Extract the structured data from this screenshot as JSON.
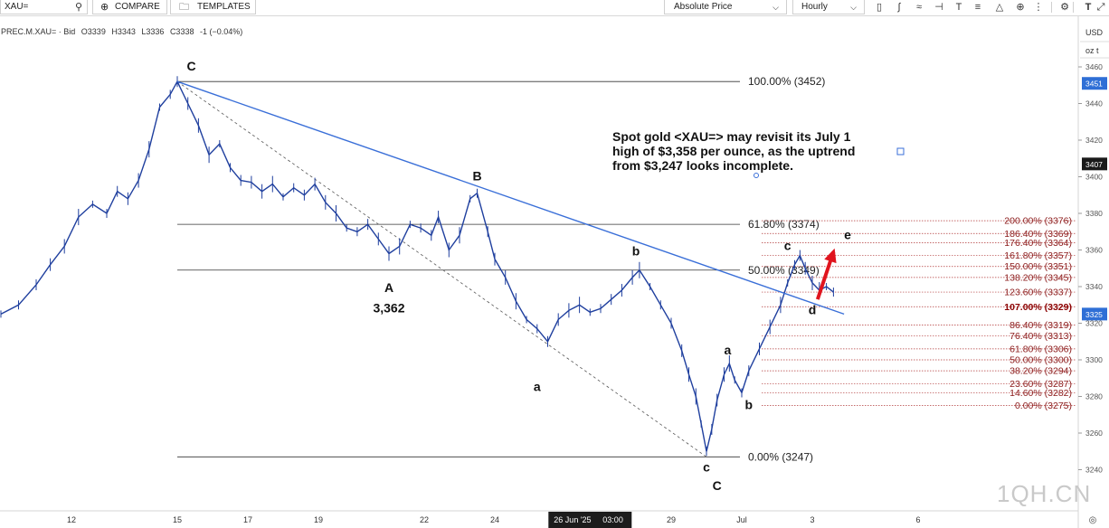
{
  "toolbar": {
    "symbol_value": "XAU=",
    "compare_label": "COMPARE",
    "templates_label": "TEMPLATES",
    "price_type": "Absolute Price",
    "interval": "Hourly",
    "tools": [
      "candles-icon",
      "indicators-icon",
      "wave-icon",
      "crosshair-icon",
      "text-tool-icon",
      "fib-tool-icon",
      "pattern-tool-icon",
      "zoom-icon",
      "more-icon",
      "settings-icon",
      "logo-icon"
    ]
  },
  "legend": {
    "instrument": "PREC.M.XAU= · Bid",
    "open": "O3339",
    "high": "H3343",
    "low": "L3336",
    "close": "C3338",
    "change": "-1 (−0.04%)"
  },
  "price_axis": {
    "currency": "USD",
    "unit": "oz t",
    "ticks": [
      3460,
      3440,
      3420,
      3400,
      3380,
      3360,
      3340,
      3320,
      3300,
      3280,
      3260,
      3240
    ],
    "badges": [
      {
        "label": "3451",
        "value": 3451,
        "color": "#2f6fd6"
      },
      {
        "label": "3407",
        "value": 3407,
        "color": "#1a1a1a"
      },
      {
        "label": "3325",
        "value": 3325,
        "color": "#2f6fd6"
      }
    ]
  },
  "time_axis": {
    "ticks": [
      {
        "label": "12",
        "day": 12
      },
      {
        "label": "15",
        "day": 15
      },
      {
        "label": "17",
        "day": 17
      },
      {
        "label": "19",
        "day": 19
      },
      {
        "label": "22",
        "day": 22
      },
      {
        "label": "24",
        "day": 24
      },
      {
        "label": "29",
        "day": 29
      },
      {
        "label": "Jul",
        "day": 31
      },
      {
        "label": "3",
        "day": 33
      },
      {
        "label": "6",
        "day": 36
      }
    ],
    "highlight": {
      "label": "26 Jun '25",
      "time": "03:00",
      "day": 26.7
    }
  },
  "annotation": [
    "Spot gold <XAU=> may revisit its July 1",
    "high of $3,358 per ounce, as the uptrend",
    "from $3,247 looks incomplete."
  ],
  "watermark": "1QH.CN",
  "chart_data": {
    "type": "line",
    "title": "",
    "xlabel": "",
    "ylabel": "",
    "ylim": [
      3228,
      3470
    ],
    "x_unit": "day",
    "series": [
      {
        "values": [
          [
            10.0,
            3325
          ],
          [
            10.5,
            3330
          ],
          [
            11.0,
            3341
          ],
          [
            11.4,
            3352
          ],
          [
            11.8,
            3362
          ],
          [
            12.2,
            3378
          ],
          [
            12.6,
            3385
          ],
          [
            13.0,
            3380
          ],
          [
            13.3,
            3392
          ],
          [
            13.6,
            3388
          ],
          [
            13.9,
            3398
          ],
          [
            14.2,
            3415
          ],
          [
            14.5,
            3438
          ],
          [
            14.8,
            3445
          ],
          [
            15.0,
            3452
          ],
          [
            15.3,
            3440
          ],
          [
            15.6,
            3428
          ],
          [
            15.9,
            3412
          ],
          [
            16.2,
            3418
          ],
          [
            16.5,
            3405
          ],
          [
            16.8,
            3398
          ],
          [
            17.1,
            3397
          ],
          [
            17.4,
            3392
          ],
          [
            17.7,
            3396
          ],
          [
            18.0,
            3389
          ],
          [
            18.3,
            3394
          ],
          [
            18.6,
            3390
          ],
          [
            18.9,
            3396
          ],
          [
            19.2,
            3386
          ],
          [
            19.5,
            3380
          ],
          [
            19.8,
            3372
          ],
          [
            20.1,
            3370
          ],
          [
            20.4,
            3374
          ],
          [
            20.7,
            3366
          ],
          [
            21.0,
            3358
          ],
          [
            21.3,
            3362
          ],
          [
            21.6,
            3374
          ],
          [
            21.9,
            3372
          ],
          [
            22.2,
            3368
          ],
          [
            22.4,
            3378
          ],
          [
            22.7,
            3360
          ],
          [
            23.0,
            3368
          ],
          [
            23.3,
            3388
          ],
          [
            23.5,
            3391
          ],
          [
            23.8,
            3370
          ],
          [
            24.0,
            3355
          ],
          [
            24.3,
            3345
          ],
          [
            24.6,
            3332
          ],
          [
            24.9,
            3322
          ],
          [
            25.2,
            3317
          ],
          [
            25.5,
            3310
          ],
          [
            25.8,
            3322
          ],
          [
            26.1,
            3327
          ],
          [
            26.4,
            3330
          ],
          [
            26.7,
            3326
          ],
          [
            27.0,
            3328
          ],
          [
            27.3,
            3333
          ],
          [
            27.6,
            3338
          ],
          [
            27.9,
            3345
          ],
          [
            28.1,
            3349
          ],
          [
            28.4,
            3340
          ],
          [
            28.7,
            3330
          ],
          [
            29.0,
            3320
          ],
          [
            29.3,
            3305
          ],
          [
            29.5,
            3292
          ],
          [
            29.7,
            3280
          ],
          [
            29.85,
            3265
          ],
          [
            30.0,
            3250
          ],
          [
            30.15,
            3262
          ],
          [
            30.3,
            3278
          ],
          [
            30.5,
            3292
          ],
          [
            30.65,
            3298
          ],
          [
            30.8,
            3289
          ],
          [
            31.0,
            3282
          ],
          [
            31.2,
            3294
          ],
          [
            31.5,
            3306
          ],
          [
            31.8,
            3318
          ],
          [
            32.1,
            3330
          ],
          [
            32.3,
            3342
          ],
          [
            32.5,
            3352
          ],
          [
            32.65,
            3357
          ],
          [
            32.8,
            3350
          ],
          [
            33.0,
            3342
          ],
          [
            33.2,
            3338
          ],
          [
            33.4,
            3340
          ],
          [
            33.6,
            3337
          ]
        ]
      }
    ],
    "trend_line": {
      "from": [
        15.0,
        3452
      ],
      "to": [
        33.9,
        3325
      ]
    },
    "dashed_line": {
      "from": [
        15.0,
        3452
      ],
      "to": [
        30.0,
        3247
      ]
    },
    "fib_major": [
      {
        "label": "100.00% (3452)",
        "value": 3452
      },
      {
        "label": "61.80% (3374)",
        "value": 3374
      },
      {
        "label": "50.00% (3349)",
        "value": 3349
      },
      {
        "label": "0.00% (3247)",
        "value": 3247
      }
    ],
    "fib_minor": [
      {
        "label": "200.00% (3376)",
        "value": 3376,
        "bold": false
      },
      {
        "label": "186.40% (3369)",
        "value": 3369,
        "bold": false
      },
      {
        "label": "176.40% (3364)",
        "value": 3364,
        "bold": false
      },
      {
        "label": "161.80% (3357)",
        "value": 3357,
        "bold": false
      },
      {
        "label": "150.00% (3351)",
        "value": 3351,
        "bold": false
      },
      {
        "label": "138.20% (3345)",
        "value": 3345,
        "bold": false
      },
      {
        "label": "123.60% (3337)",
        "value": 3337,
        "bold": false
      },
      {
        "label": "107.00% (3329)",
        "value": 3329,
        "bold": true
      },
      {
        "label": "86.40% (3319)",
        "value": 3319,
        "bold": false
      },
      {
        "label": "76.40% (3313)",
        "value": 3313,
        "bold": false
      },
      {
        "label": "61.80% (3306)",
        "value": 3306,
        "bold": false
      },
      {
        "label": "50.00% (3300)",
        "value": 3300,
        "bold": false
      },
      {
        "label": "38.20% (3294)",
        "value": 3294,
        "bold": false
      },
      {
        "label": "23.60% (3287)",
        "value": 3287,
        "bold": false
      },
      {
        "label": "14.60% (3282)",
        "value": 3282,
        "bold": false
      },
      {
        "label": "0.00% (3275)",
        "value": 3275,
        "bold": false
      }
    ],
    "wave_labels": [
      {
        "text": "C",
        "x": 15.4,
        "y": 3458,
        "bold": true
      },
      {
        "text": "B",
        "x": 23.5,
        "y": 3398,
        "bold": true
      },
      {
        "text": "A",
        "x": 21.0,
        "y": 3337,
        "bold": true
      },
      {
        "text": "3,362",
        "x": 21.0,
        "y": 3326,
        "bold": true
      },
      {
        "text": "b",
        "x": 28.0,
        "y": 3357,
        "bold": true
      },
      {
        "text": "a",
        "x": 25.2,
        "y": 3283,
        "bold": true
      },
      {
        "text": "c",
        "x": 30.0,
        "y": 3239,
        "bold": true
      },
      {
        "text": "C",
        "x": 30.3,
        "y": 3229,
        "bold": true
      },
      {
        "text": "a",
        "x": 30.6,
        "y": 3303,
        "bold": true
      },
      {
        "text": "b",
        "x": 31.2,
        "y": 3273,
        "bold": true
      },
      {
        "text": "c",
        "x": 32.3,
        "y": 3360,
        "bold": true
      },
      {
        "text": "d",
        "x": 33.0,
        "y": 3325,
        "bold": true
      },
      {
        "text": "e",
        "x": 34.0,
        "y": 3366,
        "bold": true
      }
    ],
    "arrow": {
      "from": [
        33.15,
        3333
      ],
      "to": [
        33.6,
        3359
      ],
      "color": "#e0141e"
    }
  }
}
